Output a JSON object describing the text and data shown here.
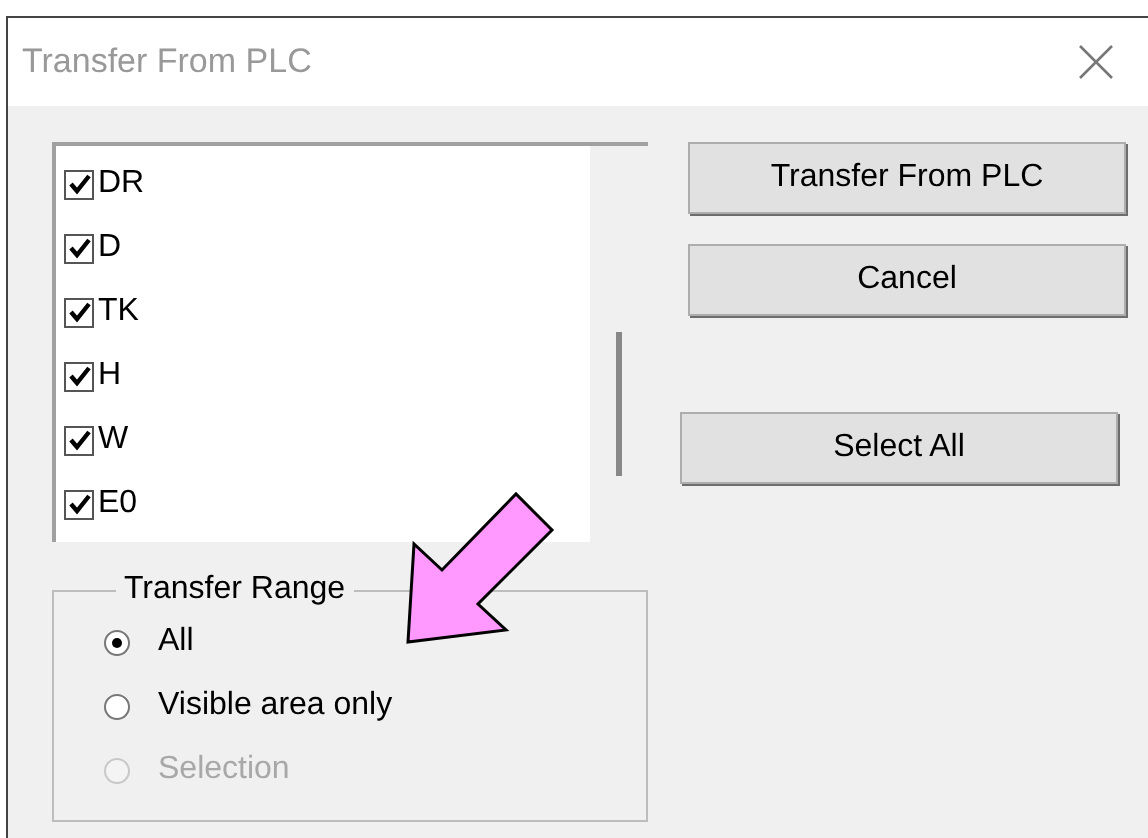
{
  "window": {
    "title": "Transfer From PLC"
  },
  "items": [
    {
      "label": "DR",
      "checked": true
    },
    {
      "label": "D",
      "checked": true
    },
    {
      "label": "TK",
      "checked": true
    },
    {
      "label": "H",
      "checked": true
    },
    {
      "label": "W",
      "checked": true
    },
    {
      "label": "E0",
      "checked": true
    }
  ],
  "buttons": [
    "Transfer From PLC",
    "Cancel",
    "Select All"
  ],
  "transfer_range": {
    "label": "Transfer Range",
    "options": [
      {
        "label": "All",
        "selected": true,
        "disabled": false
      },
      {
        "label": "Visible area only",
        "selected": false,
        "disabled": false
      },
      {
        "label": "Selection",
        "selected": false,
        "disabled": true
      }
    ]
  }
}
